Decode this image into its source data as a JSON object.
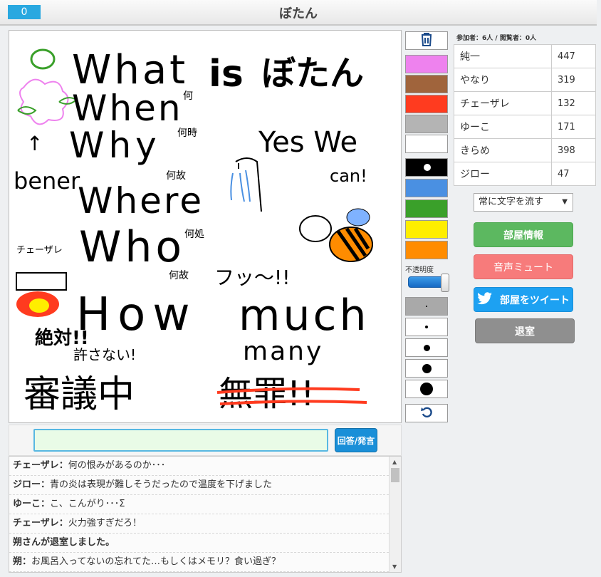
{
  "header": {
    "counter": "0",
    "title": "ぼたん"
  },
  "drawing": {
    "texts": [
      "What",
      "is",
      "ぼたん",
      "何",
      "When",
      "何時",
      "↑",
      "Why",
      "何故",
      "bener",
      "Where",
      "Yes We",
      "can!",
      "何処",
      "Who",
      "何故",
      "チェーザレ",
      "フッ〜!!",
      "How",
      "much",
      "many",
      "絶対!!",
      "許さない!",
      "審議中",
      "無罪!!"
    ]
  },
  "tools": {
    "trash_icon": "trash-icon",
    "colors": [
      "#ee82ee",
      "#a0643c",
      "#ff3b1f",
      "#b4b4b4",
      "#ffffff",
      "#000000",
      "#4a90e2",
      "#3aa02a",
      "#ffee00",
      "#ff8c00"
    ],
    "opacity_label": "不透明度",
    "opacity_value": 1.0,
    "sizes": [
      "1",
      "2",
      "3",
      "4",
      "5"
    ],
    "undo_icon": "undo-icon"
  },
  "room": {
    "participants": "参加者：6人 / 閲覧者：0人",
    "scores": [
      {
        "name": "純一",
        "score": "447"
      },
      {
        "name": "やなり",
        "score": "319"
      },
      {
        "name": "チェーザレ",
        "score": "132"
      },
      {
        "name": "ゆーこ",
        "score": "171"
      },
      {
        "name": "きらめ",
        "score": "398"
      },
      {
        "name": "ジロー",
        "score": "47"
      }
    ],
    "text_mode": "常に文字を流す",
    "info_button": "部屋情報",
    "mute_button": "音声ミュート",
    "tweet_button": "部屋をツイート",
    "leave_button": "退室"
  },
  "answer": {
    "value": "",
    "placeholder": "",
    "button": "回答/発言"
  },
  "chat": [
    {
      "name": "チェーザレ",
      "sep": "：",
      "text": "何の恨みがあるのか･･･"
    },
    {
      "name": "ジロー",
      "sep": "：",
      "text": "青の炎は表現が難しそうだったので温度を下げました"
    },
    {
      "name": "ゆーこ",
      "sep": "：",
      "text": "こ、こんがり･･･Σ"
    },
    {
      "name": "チェーザレ",
      "sep": "：",
      "text": "火力強すぎだろ！"
    },
    {
      "name": "朔さんが退室しました。",
      "sep": "",
      "text": ""
    },
    {
      "name": "朔",
      "sep": "：",
      "text": "お風呂入ってないの忘れてた…もしくはメモリ？食い過ぎ？"
    }
  ]
}
